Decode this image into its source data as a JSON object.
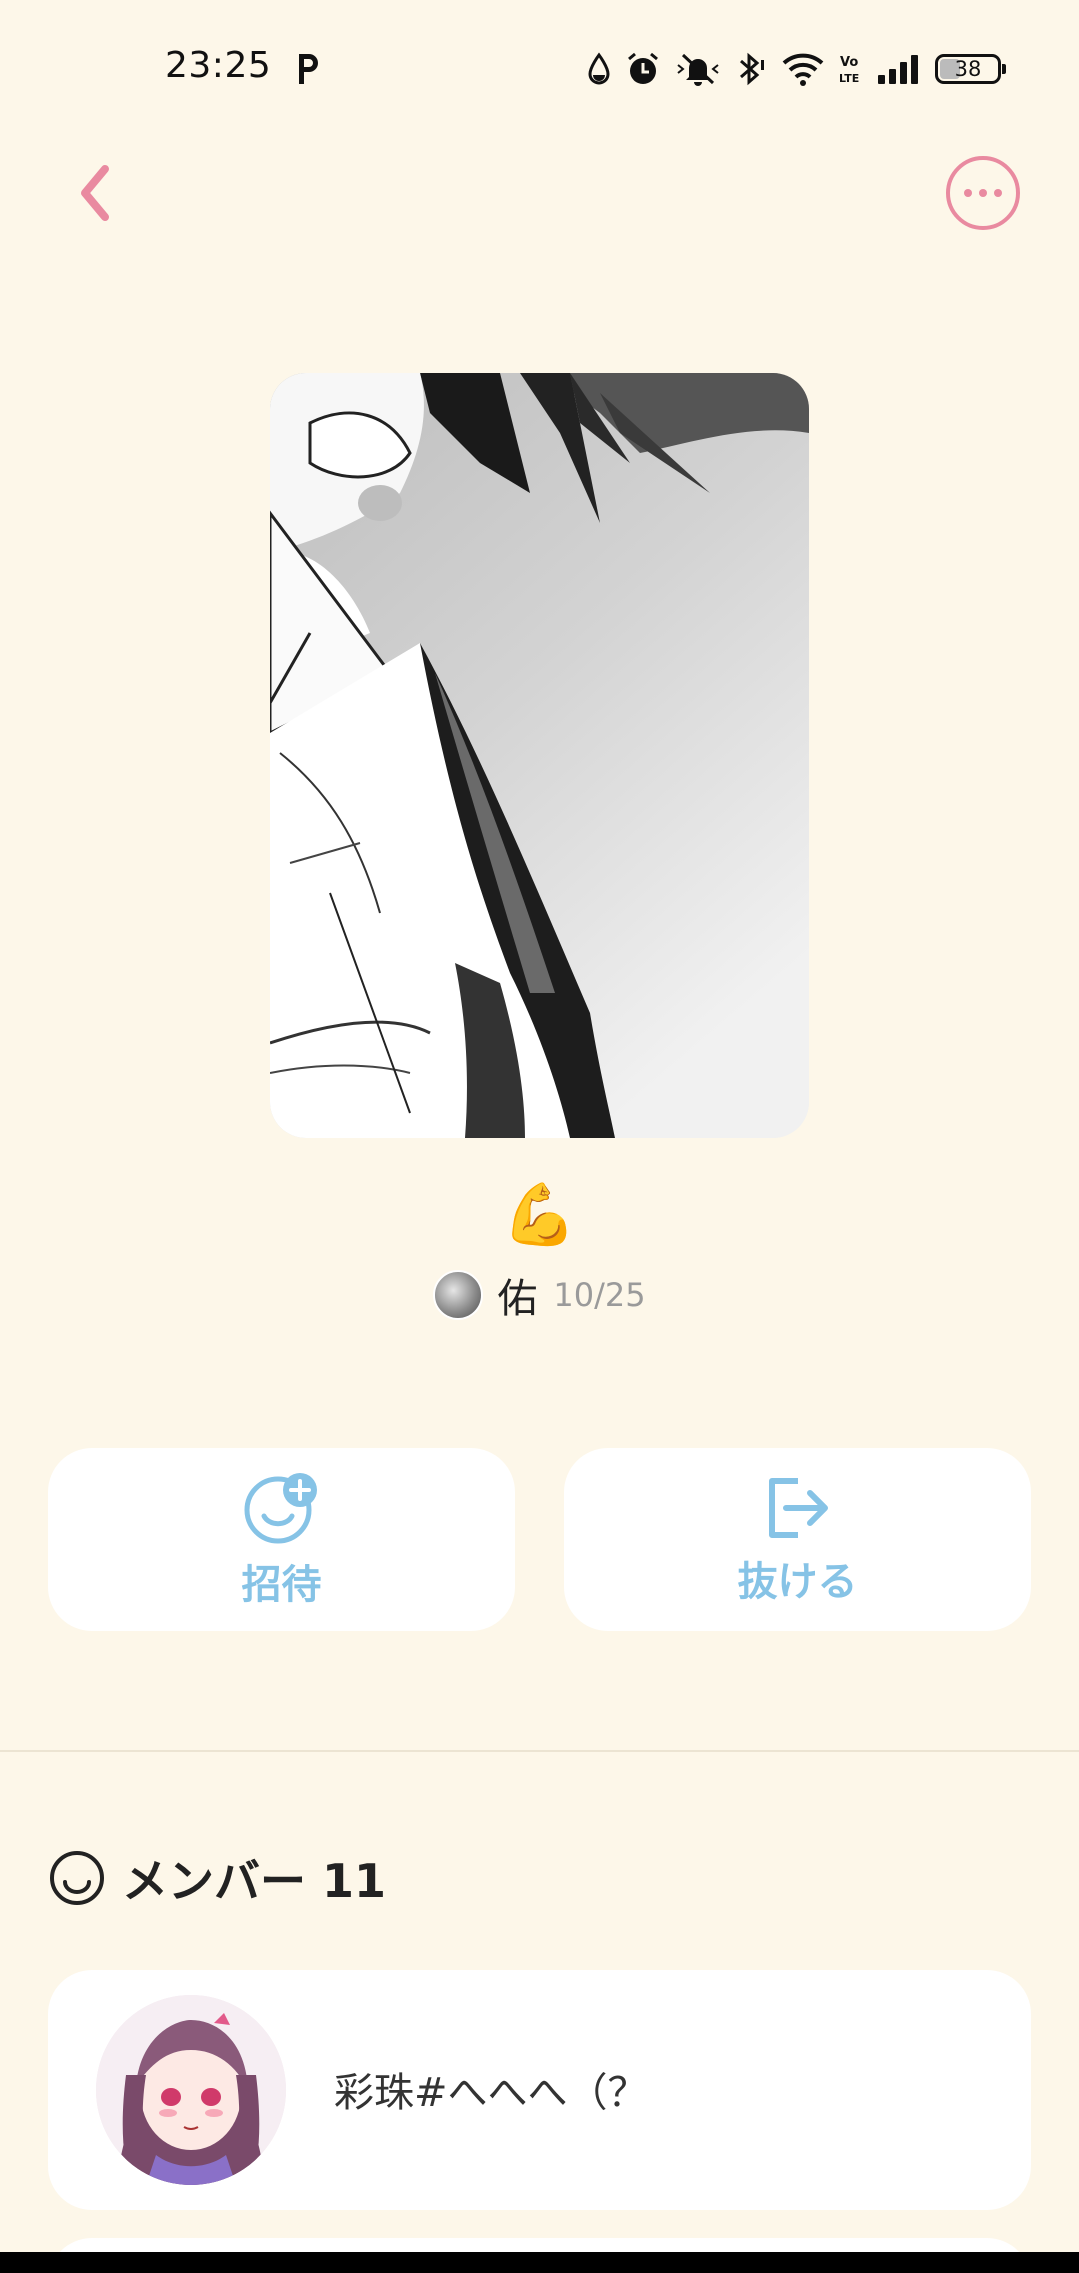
{
  "status_bar": {
    "time": "23:25",
    "carrier_icon": "p-letter-icon",
    "battery": "38",
    "icons": [
      "water-drop-icon",
      "alarm-icon",
      "bell-muted-icon",
      "bluetooth-icon",
      "wifi-icon",
      "volte-icon",
      "signal-icon",
      "battery-icon"
    ]
  },
  "nav": {
    "back_icon": "chevron-left-icon",
    "more_icon": "more-horizontal-icon"
  },
  "post": {
    "emoji": "💪",
    "author_name": "佑",
    "date": "10/25"
  },
  "actions": {
    "invite_label": "招待",
    "invite_icon": "face-plus-icon",
    "leave_label": "抜ける",
    "leave_icon": "exit-icon"
  },
  "members": {
    "title": "メンバー 11",
    "icon": "smile-icon",
    "list": [
      {
        "name": "彩珠#へへへ（？"
      }
    ]
  },
  "colors": {
    "background": "#fdf7e9",
    "accent_pink": "#e98aa0",
    "accent_blue": "#86c3e6",
    "card": "#ffffff"
  }
}
